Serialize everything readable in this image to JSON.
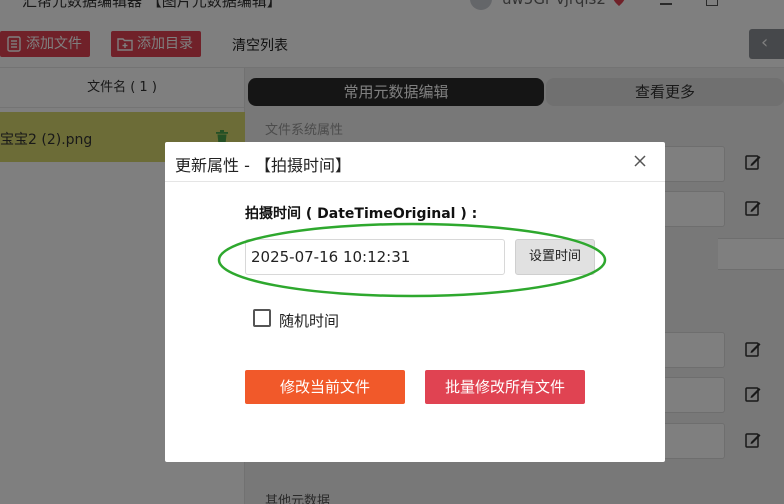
{
  "app": {
    "title": "汇帮元数据编辑器 【图片元数据编辑】",
    "user_name": "uw5Gr vjrqls2"
  },
  "toolbar": {
    "add_file_label": "添加文件",
    "add_folder_label": "添加目录",
    "clear_list_label": "清空列表",
    "collapse_label": "‹"
  },
  "file_list": {
    "header": "文件名 ( 1 )",
    "items": [
      {
        "name": "宝宝2 (2).png"
      }
    ]
  },
  "metadata_panel": {
    "tabs": [
      {
        "label": "常用元数据编辑"
      },
      {
        "label": "查看更多"
      }
    ],
    "section_filesystem": "文件系统属性",
    "section_other": "其他元数据"
  },
  "dialog": {
    "title": "更新属性 - 【拍摄时间】",
    "field_label": "拍摄时间 ( DateTimeOriginal ) :",
    "time_value": "2025-07-16 10:12:31",
    "set_time_label": "设置时间",
    "random_time_label": "随机时间",
    "random_time_checked": false,
    "modify_current_label": "修改当前文件",
    "batch_modify_label": "批量修改所有文件"
  },
  "colors": {
    "primary_red": "#e04352",
    "orange": "#f1592a",
    "highlight_yellow": "#d9d96e",
    "annotation_green": "#2ea82e",
    "tab_dark": "#2b2b2b"
  }
}
